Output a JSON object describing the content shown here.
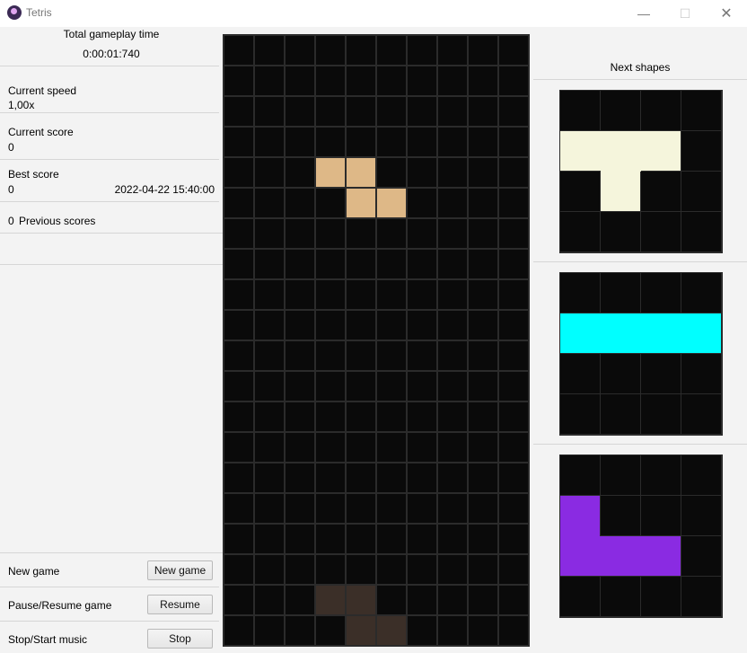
{
  "window": {
    "title": "Tetris",
    "icon": "app-icon"
  },
  "stats": {
    "time_label": "Total gameplay time",
    "time_value": "0:00:01:740",
    "speed_label": "Current speed",
    "speed_value": "1,00x",
    "score_label": "Current score",
    "score_value": "0",
    "best_label": "Best score",
    "best_value": "0",
    "best_date": "2022-04-22 15:40:00",
    "prev_count": "0",
    "prev_label": "Previous scores"
  },
  "controls": [
    {
      "label": "New game",
      "button": "New game"
    },
    {
      "label": "Pause/Resume game",
      "button": "Resume"
    },
    {
      "label": "Stop/Start music",
      "button": "Stop"
    }
  ],
  "board": {
    "cols": 10,
    "rows": 20,
    "empty_color": "#0a0a0a",
    "grid_color": "#2b2b2b",
    "active_piece": {
      "shape": "Z",
      "color": "#deb887",
      "cells": [
        [
          3,
          4
        ],
        [
          4,
          4
        ],
        [
          4,
          5
        ],
        [
          5,
          5
        ]
      ]
    },
    "ghost_piece": {
      "color": "#3b2f28",
      "cells": [
        [
          3,
          18
        ],
        [
          4,
          18
        ],
        [
          4,
          19
        ],
        [
          5,
          19
        ]
      ]
    }
  },
  "next": {
    "title": "Next shapes",
    "shapes": [
      {
        "shape": "T",
        "color": "#f5f5dc",
        "cells": [
          [
            0,
            1
          ],
          [
            1,
            1
          ],
          [
            2,
            1
          ],
          [
            1,
            2
          ]
        ]
      },
      {
        "shape": "I",
        "color": "#00ffff",
        "cells": [
          [
            0,
            1
          ],
          [
            1,
            1
          ],
          [
            2,
            1
          ],
          [
            3,
            1
          ]
        ]
      },
      {
        "shape": "J",
        "color": "#8a2be2",
        "cells": [
          [
            0,
            1
          ],
          [
            0,
            2
          ],
          [
            1,
            2
          ],
          [
            2,
            2
          ]
        ]
      }
    ]
  }
}
